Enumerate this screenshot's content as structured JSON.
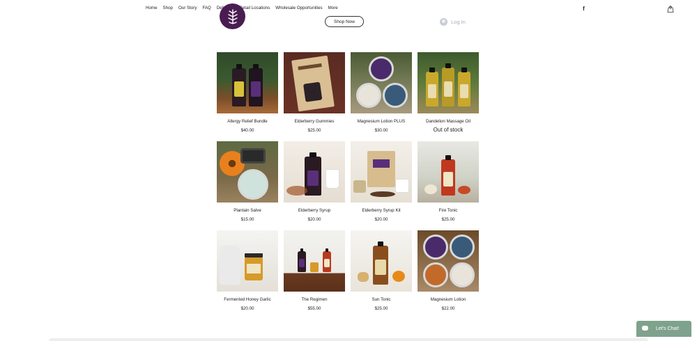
{
  "nav": {
    "items": [
      "Home",
      "Shop",
      "Our Story",
      "FAQ",
      "Delivery",
      "Retail Locations",
      "Wholesale Opportunities",
      "More"
    ]
  },
  "header": {
    "shop_now_label": "Shop Now",
    "login_label": "Log In",
    "cart_count": "0",
    "facebook_glyph": "f"
  },
  "colors": {
    "brand_purple": "#4a1d52",
    "chat_green": "#7fa28c"
  },
  "products": [
    {
      "name": "Allergy Relief Bundle",
      "price": "$40.00"
    },
    {
      "name": "Elderberry Gummies",
      "price": "$25.00"
    },
    {
      "name": "Magnesium Lotion PLUS",
      "price": "$30.00"
    },
    {
      "name": "Dandelion Massage Oil",
      "price": "Out of stock"
    },
    {
      "name": "Plantain Salve",
      "price": "$15.00"
    },
    {
      "name": "Elderberry Syrup",
      "price": "$20.00"
    },
    {
      "name": "Elderberry Syrup Kit",
      "price": "$20.00"
    },
    {
      "name": "Fire Tonic",
      "price": "$25.00"
    },
    {
      "name": "Fermented Honey Garlic",
      "price": "$20.00"
    },
    {
      "name": "The Regimen",
      "price": "$55.00"
    },
    {
      "name": "Sun Tonic",
      "price": "$25.00"
    },
    {
      "name": "Magnesium Lotion",
      "price": "$22.00"
    }
  ],
  "chat": {
    "label": "Let's Chat!"
  }
}
